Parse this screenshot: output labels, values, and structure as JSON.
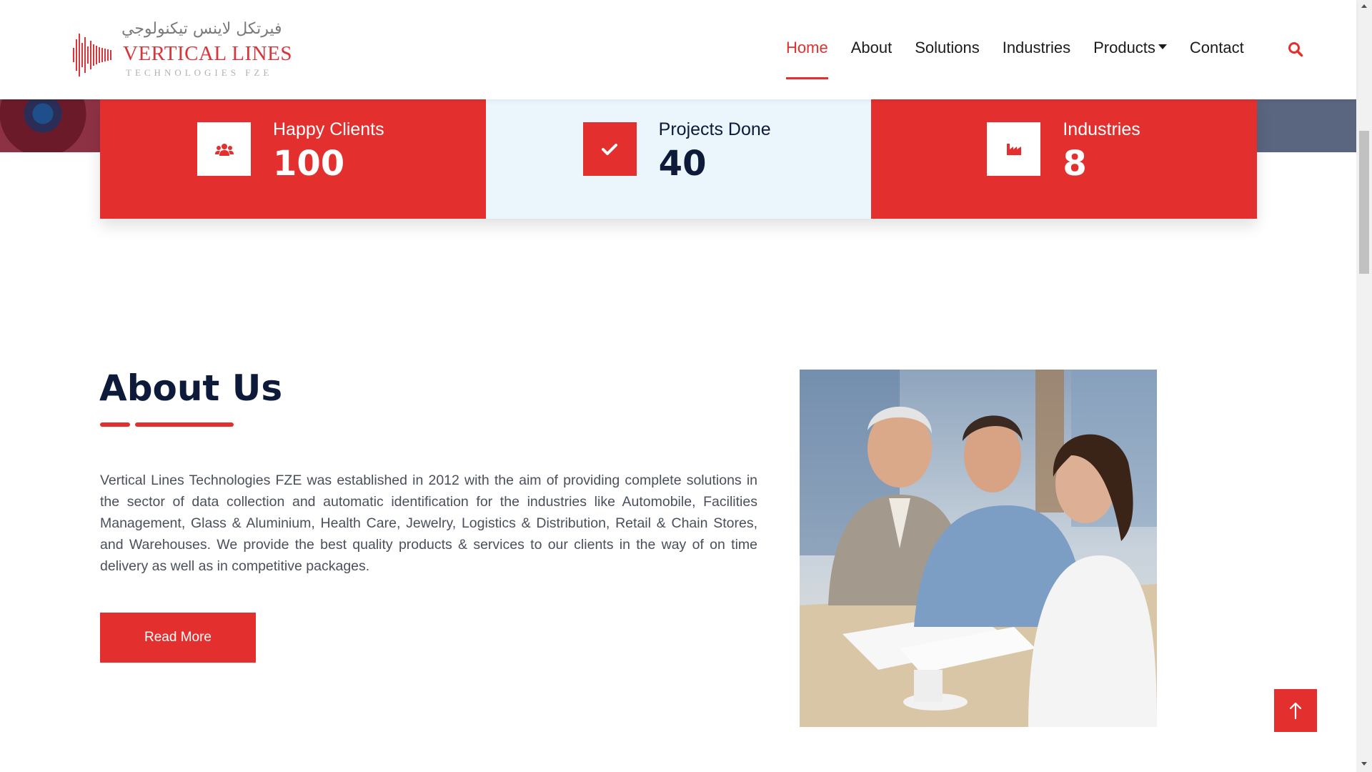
{
  "logo": {
    "arabic_text": "فيرتكل لاينس تيكنولوجي",
    "brand": "VERTICAL LINES",
    "sub": "TECHNOLOGIES FZE"
  },
  "nav": {
    "items": [
      {
        "label": "Home",
        "active": true
      },
      {
        "label": "About"
      },
      {
        "label": "Solutions"
      },
      {
        "label": "Industries"
      },
      {
        "label": "Products",
        "dropdown": true
      },
      {
        "label": "Contact"
      }
    ],
    "search_icon": "search-icon"
  },
  "stats": [
    {
      "label": "Happy Clients",
      "value": "100",
      "icon": "users-icon",
      "style": "red"
    },
    {
      "label": "Projects Done",
      "value": "40",
      "icon": "check-icon",
      "style": "light"
    },
    {
      "label": "Industries",
      "value": "8",
      "icon": "industry-icon",
      "style": "red"
    }
  ],
  "about": {
    "title": "About Us",
    "text": "Vertical Lines Technologies FZE was established in 2012 with the aim of providing complete solutions in the sector of data collection and automatic identification for the industries like Automobile, Facilities Management, Glass & Aluminium, Health Care, Jewelry, Logistics & Distribution, Retail & Chain Stores, and Warehouses. We provide the best quality products & services to our clients in the way of on time delivery as well as in competitive packages.",
    "button": "Read More"
  },
  "colors": {
    "accent": "#e3302f",
    "navy": "#0d1a3a",
    "light_panel": "#eaf5fc"
  }
}
